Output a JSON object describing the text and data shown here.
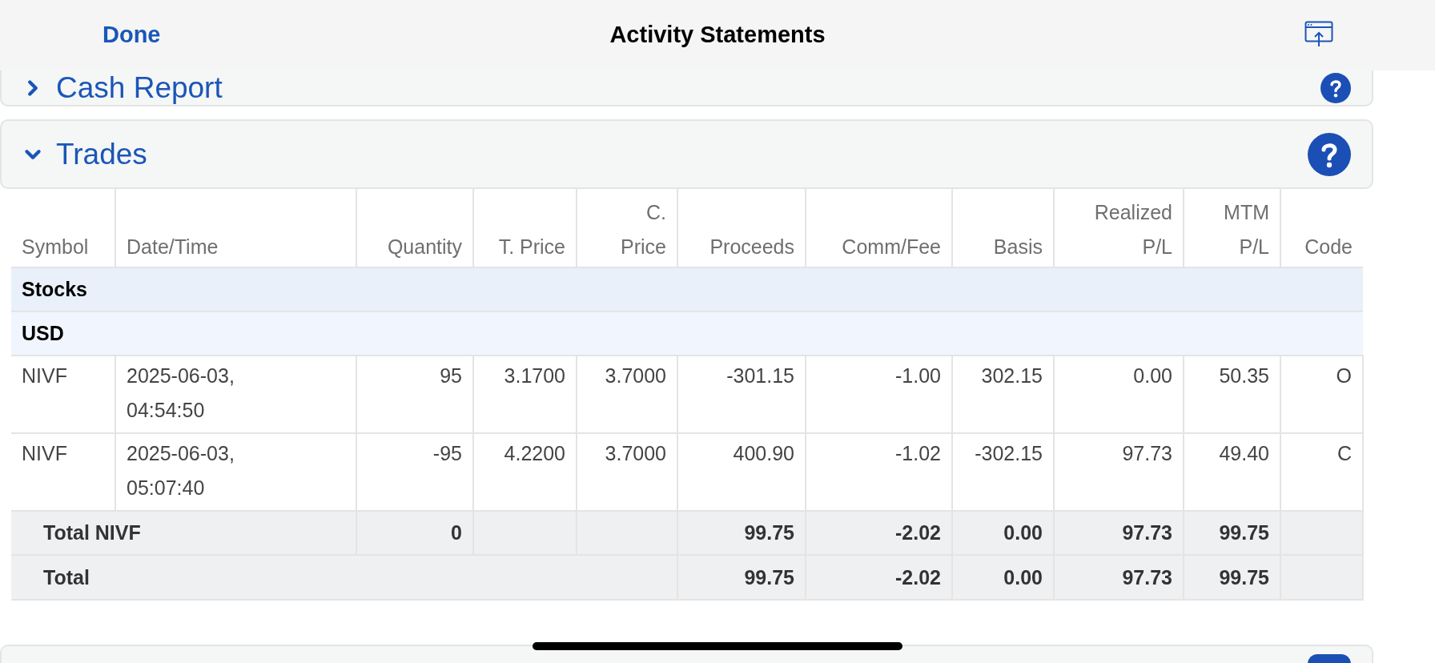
{
  "header": {
    "done": "Done",
    "title": "Activity Statements"
  },
  "sections": [
    {
      "title": "Cash Report",
      "expanded": false
    },
    {
      "title": "Trades",
      "expanded": true
    }
  ],
  "table": {
    "columns": [
      {
        "lines": [
          "Symbol"
        ]
      },
      {
        "lines": [
          "Date/Time"
        ]
      },
      {
        "lines": [
          "Quantity"
        ]
      },
      {
        "lines": [
          "T. Price"
        ]
      },
      {
        "lines": [
          "C.",
          "Price"
        ]
      },
      {
        "lines": [
          "Proceeds"
        ]
      },
      {
        "lines": [
          "Comm/Fee"
        ]
      },
      {
        "lines": [
          "Basis"
        ]
      },
      {
        "lines": [
          "Realized",
          "P/L"
        ]
      },
      {
        "lines": [
          "MTM",
          "P/L"
        ]
      },
      {
        "lines": [
          "Code"
        ]
      }
    ],
    "rows": [
      {
        "kind": "group",
        "label": "Stocks"
      },
      {
        "kind": "subgroup",
        "label": "USD"
      },
      {
        "kind": "data",
        "cells": [
          [
            "NIVF"
          ],
          [
            "2025-06-03,",
            "04:54:50"
          ],
          [
            "95"
          ],
          [
            "3.1700"
          ],
          [
            "3.7000"
          ],
          [
            "-301.15"
          ],
          [
            "-1.00"
          ],
          [
            "302.15"
          ],
          [
            "0.00"
          ],
          [
            "50.35"
          ],
          [
            "O"
          ]
        ]
      },
      {
        "kind": "data",
        "cells": [
          [
            "NIVF"
          ],
          [
            "2025-06-03,",
            "05:07:40"
          ],
          [
            "-95"
          ],
          [
            "4.2200"
          ],
          [
            "3.7000"
          ],
          [
            "400.90"
          ],
          [
            "-1.02"
          ],
          [
            "-302.15"
          ],
          [
            "97.73"
          ],
          [
            "49.40"
          ],
          [
            "C"
          ]
        ]
      },
      {
        "kind": "subtotal",
        "label": "Total NIVF",
        "cells": [
          "0",
          null,
          null,
          "99.75",
          "-2.02",
          "0.00",
          "97.73",
          "99.75",
          null
        ]
      },
      {
        "kind": "total",
        "label": "Total",
        "cells": [
          "99.75",
          "-2.02",
          "0.00",
          "97.73",
          "99.75",
          null
        ]
      }
    ]
  }
}
